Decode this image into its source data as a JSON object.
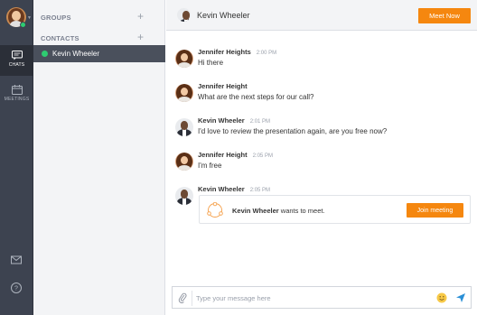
{
  "rail": {
    "chats_label": "CHATS",
    "meetings_label": "MEETINGS"
  },
  "panel": {
    "groups_title": "GROUPS",
    "contacts_title": "CONTACTS",
    "contacts": [
      {
        "name": "Kevin Wheeler",
        "online": true,
        "selected": true
      }
    ]
  },
  "header": {
    "name": "Kevin Wheeler",
    "meet_now_label": "Meet Now"
  },
  "messages": [
    {
      "sender": "Jennifer Heights",
      "time": "2:00 PM",
      "text": "Hi there",
      "avatar": "female"
    },
    {
      "sender": "Jennifer Height",
      "time": "",
      "text": "What are the next steps for our call?",
      "avatar": "female"
    },
    {
      "sender": "Kevin Wheeler",
      "time": "2:01 PM",
      "text": "I'd love to review the presentation again, are you free now?",
      "avatar": "male"
    },
    {
      "sender": "Jennifer Height",
      "time": "2:05 PM",
      "text": "I'm free",
      "avatar": "female"
    },
    {
      "sender": "Kevin Wheeler",
      "time": "2:05 PM",
      "text": "",
      "avatar": "male"
    }
  ],
  "meeting_card": {
    "requester": "Kevin Wheeler",
    "request_text": " wants to meet.",
    "join_label": "Join meeting"
  },
  "composer": {
    "placeholder": "Type your message here"
  },
  "colors": {
    "accent": "#f5870f",
    "rail_bg": "#3d4350",
    "online": "#2ecc71"
  }
}
